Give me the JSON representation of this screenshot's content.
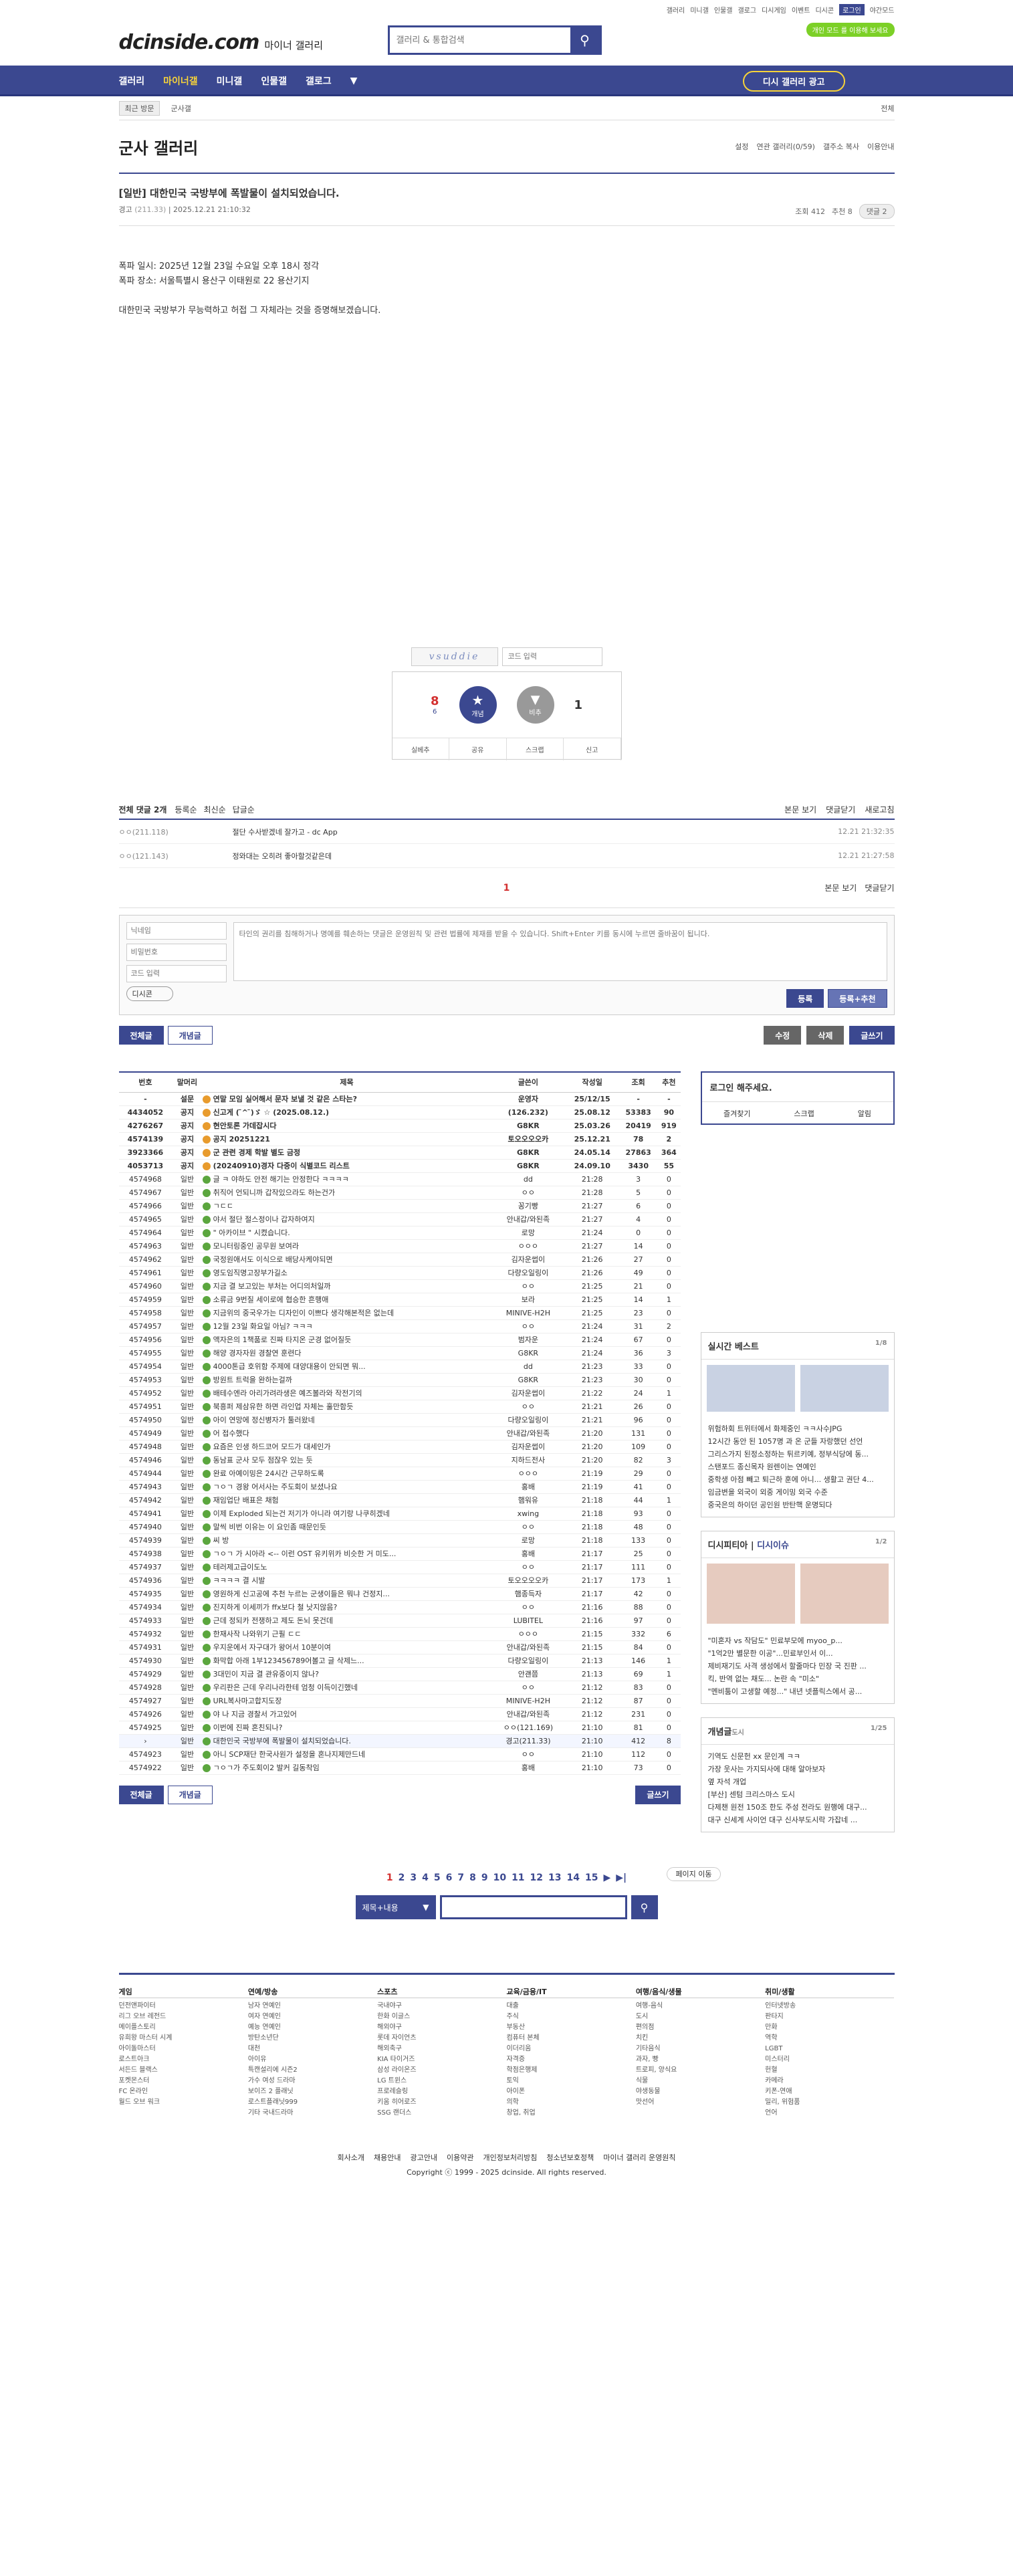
{
  "util": {
    "links": [
      "갤러리",
      "미니갤",
      "인물갤",
      "갤로그",
      "디시게임",
      "이벤트",
      "디시콘"
    ],
    "login": "로그인",
    "night": "야간모드"
  },
  "header": {
    "logo": "dcinside.com",
    "sub": "마이너 갤러리",
    "search_placeholder": "갤러리 & 통합검색",
    "badge": "개인 모드 를 이용해 보세요"
  },
  "gnb": {
    "items": [
      "갤러리",
      "마이너갤",
      "미니갤",
      "인물갤",
      "갤로그"
    ],
    "history": "디시 갤러리 광고"
  },
  "lnb": {
    "recent": "최근 방문",
    "item": "군사갤",
    "all": "전체"
  },
  "gallery": {
    "title": "군사 갤러리",
    "opts": [
      "설정",
      "연관 갤러리(0/59)",
      "갤주소 복사",
      "이용안내"
    ]
  },
  "post": {
    "title": "[일반] 대한민국 국방부에 폭발물이 설치되었습니다.",
    "author": "경고",
    "ip": "(211.33)",
    "date": "2025.12.21 21:10:32",
    "views": "조회 412",
    "recs": "추천 8",
    "comments": "댓글 2",
    "body": [
      "폭파 일시: 2025년 12월 23일 수요일 오후 18시 정각",
      "폭파 장소: 서울특별시 용산구 이태원로 22 용산기지",
      "",
      "대한민국 국방부가 무능력하고 허접 그 자체라는 것을 증명해보겠습니다."
    ]
  },
  "captcha": {
    "code": "vsuddie",
    "placeholder": "코드 입력"
  },
  "vote": {
    "up": "8",
    "up_sub": "6",
    "down": "1",
    "up_label": "개념",
    "down_label": "비추",
    "bottom": [
      "실베추",
      "공유",
      "스크랩",
      "신고"
    ]
  },
  "cmt": {
    "total": "전체 댓글 2개",
    "tabs": [
      "등록순",
      "최신순",
      "답글순"
    ],
    "right": [
      "본문 보기",
      "댓글닫기",
      "새로고침"
    ],
    "items": [
      {
        "nick": "ㅇㅇ(211.118)",
        "text": "절단 수사받겠네 잘가고 - dc App",
        "date": "12.21 21:32:35"
      },
      {
        "nick": "ㅇㅇ(121.143)",
        "text": "정와대는 오히려 좋아할것같은데",
        "date": "12.21 21:27:58"
      }
    ],
    "page": "1",
    "nick_ph": "닉네임",
    "pw_ph": "비밀번호",
    "code_ph": "코드 입력",
    "text_ph": "타인의 권리를 침해하거나 명예를 훼손하는 댓글은 운영원칙 및 관련 법률에 제재를 받을 수 있습니다. Shift+Enter 키를 동시에 누르면 줄바꿈이 됩니다.",
    "dccon": "디시콘",
    "submit": "등록",
    "submit_rec": "등록+추천"
  },
  "actions": {
    "all": "전체글",
    "concept": "개념글",
    "edit": "수정",
    "del": "삭제",
    "write": "글쓰기"
  },
  "list": {
    "headers": [
      "번호",
      "말머리",
      "제목",
      "글쓴이",
      "작성일",
      "조회",
      "추천"
    ],
    "rows": [
      [
        "-",
        "설문",
        "연말 모임 실어해서 문자 보낼 것 같은 스타는?",
        "운영자",
        "25/12/15",
        "-",
        "-"
      ],
      [
        "4434052",
        "공지",
        "신고게 ( ̄^ ̄)ゞ ☆ (2025.08.12.)",
        "(126.232)",
        "25.08.12",
        "53383",
        "90"
      ],
      [
        "4276267",
        "공지",
        "현안토론 가데잡시다",
        "G8KR",
        "25.03.26",
        "20419",
        "919"
      ],
      [
        "4574139",
        "공지",
        "공지 20251221",
        "토오오오오카",
        "25.12.21",
        "78",
        "2"
      ],
      [
        "3923366",
        "공지",
        "군 관련 경제 학발 별도 금정",
        "G8KR",
        "24.05.14",
        "27863",
        "364"
      ],
      [
        "4053713",
        "공지",
        "(20240910)경자 다중이 식별코드 리스트",
        "G8KR",
        "24.09.10",
        "3430",
        "55"
      ],
      [
        "4574968",
        "일반",
        "글 ㅋ 야하도 안전 해기는 안정한다 ㅋㅋㅋㅋ",
        "dd",
        "21:28",
        "3",
        "0"
      ],
      [
        "4574967",
        "일반",
        "취직어 언되니까 갑작있으라도 하는건가",
        "ㅇㅇ",
        "21:28",
        "5",
        "0"
      ],
      [
        "4574966",
        "일반",
        "ㄱㄷㄷ",
        "꽁기빵",
        "21:27",
        "6",
        "0"
      ],
      [
        "4574965",
        "일반",
        "야서 절단 절스정이나 갑자하여지",
        "안내갑/와된족",
        "21:27",
        "4",
        "0"
      ],
      [
        "4574964",
        "일반",
        "\" 아카이브 \" 시켰습니다.",
        "로망",
        "21:24",
        "0",
        "0"
      ],
      [
        "4574963",
        "일반",
        "모니터링중인 공무원 보여라",
        "ㅇㅇㅇ",
        "21:27",
        "14",
        "0"
      ],
      [
        "4574962",
        "일반",
        "국정원애서도 이식으로 배당사케야되면",
        "김자운썹이",
        "21:26",
        "27",
        "0"
      ],
      [
        "4574961",
        "일반",
        "영도임직명고장부가길소",
        "다량오일링이",
        "21:26",
        "49",
        "0"
      ],
      [
        "4574960",
        "일반",
        "지금 결 보고있는 부처는 어디의처일까",
        "ㅇㅇ",
        "21:25",
        "21",
        "0"
      ],
      [
        "4574959",
        "일반",
        "소류금 9번질 세이로에 협승한 흔행애",
        "보라",
        "21:25",
        "14",
        "1"
      ],
      [
        "4574958",
        "일반",
        "지금위의 중국우가는 디자인이 이쁘다 생각해본적은 없는데",
        "MINIVE-H2H",
        "21:25",
        "23",
        "0"
      ],
      [
        "4574957",
        "일반",
        "12월 23일 화요일 아님? ㅋㅋㅋ",
        "ㅇㅇ",
        "21:24",
        "31",
        "2"
      ],
      [
        "4574956",
        "일반",
        "액자은의 1책품로 진짜 타지온 군경 없어질듯",
        "범자운",
        "21:24",
        "67",
        "0"
      ],
      [
        "4574955",
        "일반",
        "해양 경자자원 경찰연 훈련다",
        "G8KR",
        "21:24",
        "36",
        "3"
      ],
      [
        "4574954",
        "일반",
        "4000톤급 호위함 주제에 대양대용이 안되면 뭐...",
        "dd",
        "21:23",
        "33",
        "0"
      ],
      [
        "4574953",
        "일반",
        "방원트 트럭을 완하는걸까",
        "G8KR",
        "21:23",
        "30",
        "0"
      ],
      [
        "4574952",
        "일반",
        "배테수엔라 아리가려라생은 예즈볼라와 작전기의",
        "김자운썹이",
        "21:22",
        "24",
        "1"
      ],
      [
        "4574951",
        "일반",
        "북흥퍼 제삼유한 하면 라인업 자체는 훌만함듯",
        "ㅇㅇ",
        "21:21",
        "26",
        "0"
      ],
      [
        "4574950",
        "일반",
        "아이 연망에 정신병자가 툴러왔네",
        "다량오일링이",
        "21:21",
        "96",
        "0"
      ],
      [
        "4574949",
        "일반",
        "어 접수했다",
        "안내갑/와된족",
        "21:20",
        "131",
        "0"
      ],
      [
        "4574948",
        "일반",
        "요즘은 인생 하드코어 모드가 대세인가",
        "김자운썹이",
        "21:20",
        "109",
        "0"
      ],
      [
        "4574946",
        "일반",
        "동남표 군사 모두 점잖우 있는 듯",
        "지하드전사",
        "21:20",
        "82",
        "3"
      ],
      [
        "4574944",
        "일반",
        "완료 아예이밍은 24시간 근무하도록",
        "ㅇㅇㅇ",
        "21:19",
        "29",
        "0"
      ],
      [
        "4574943",
        "일반",
        "ㄱㅇㄱ 경왕 어서사는 주도회이 보셨나요",
        "홍배",
        "21:19",
        "41",
        "0"
      ],
      [
        "4574942",
        "일반",
        "재임업단 배표은 채험",
        "햄워유",
        "21:18",
        "44",
        "1"
      ],
      [
        "4574941",
        "일반",
        "이제 Exploded 되는건 저기가 아니라 여기랑 나쿠히겠네",
        "xwing",
        "21:18",
        "93",
        "0"
      ],
      [
        "4574940",
        "일반",
        "말씩 비번 이유는 이 요인좀 때문인듯",
        "ㅇㅇ",
        "21:18",
        "48",
        "0"
      ],
      [
        "4574939",
        "일반",
        "씨 방",
        "로망",
        "21:18",
        "133",
        "0"
      ],
      [
        "4574938",
        "일반",
        "ㄱㅇㄱ 가 시아라 <-- 이런 OST 유키위카 비슷한 거 미도...",
        "홍배",
        "21:17",
        "25",
        "0"
      ],
      [
        "4574937",
        "일반",
        "테러제고급이도노",
        "ㅇㅇ",
        "21:17",
        "111",
        "0"
      ],
      [
        "4574936",
        "일반",
        "ㅋㅋㅋㅋ 결 시발",
        "토오오오오카",
        "21:17",
        "173",
        "1"
      ],
      [
        "4574935",
        "일반",
        "영원하게 신고공에 추천 누르는 군생이들은 뭐냐 건정지...",
        "햄종득자",
        "21:17",
        "42",
        "0"
      ],
      [
        "4574934",
        "일반",
        "진지하게 이세끼가 ffx보다 철 낫지않음?",
        "ㅇㅇ",
        "21:16",
        "88",
        "0"
      ],
      [
        "4574933",
        "일반",
        "근데 정되카 전쟁하고 제도 돈뇌 못건데",
        "LUBITEL",
        "21:16",
        "97",
        "0"
      ],
      [
        "4574932",
        "일반",
        "한재사작 나와위기 근필 ㄷㄷ",
        "ㅇㅇㅇ",
        "21:15",
        "332",
        "6"
      ],
      [
        "4574931",
        "일반",
        "우지운에서 자구대가 왕어서 10분이여",
        "안내갑/와된족",
        "21:15",
        "84",
        "0"
      ],
      [
        "4574930",
        "일반",
        "화막합 아래 1부123456789어볼고 글 삭제느...",
        "다량오일링이",
        "21:13",
        "146",
        "1"
      ],
      [
        "4574929",
        "일반",
        "3대민이 지금 결 관유중이지 않나?",
        "안괜쯤",
        "21:13",
        "69",
        "1"
      ],
      [
        "4574928",
        "일반",
        "우리판은 근데 우리나라한테 엄청 이득이긴했네",
        "ㅇㅇ",
        "21:12",
        "83",
        "0"
      ],
      [
        "4574927",
        "일반",
        "URL복사마고합지도장",
        "MINIVE-H2H",
        "21:12",
        "87",
        "0"
      ],
      [
        "4574926",
        "일반",
        "야 나 지금 경찰서 가고있어",
        "안내갑/와된족",
        "21:12",
        "231",
        "0"
      ],
      [
        "4574925",
        "일반",
        "이번에 진짜 혼친되나?",
        "ㅇㅇ(121.169)",
        "21:10",
        "81",
        "0"
      ],
      [
        "",
        "일반",
        "대한민국 국방부에 폭발물이 설치되었습니다.",
        "경고(211.33)",
        "21:10",
        "412",
        "8"
      ],
      [
        "4574923",
        "일반",
        "아니 SCP재단 한국사원가 설정을 혼나지제만드네",
        "ㅇㅇ",
        "21:10",
        "112",
        "0"
      ],
      [
        "4574922",
        "일반",
        "ㄱㅇㄱ가 주도회이2 발커 길동착임",
        "홍배",
        "21:10",
        "73",
        "0"
      ]
    ]
  },
  "side": {
    "login": "로그인 해주세요.",
    "login_links": [
      "즐겨찾기",
      "스크랩",
      "알림"
    ],
    "best": {
      "title": "실시간 베스트",
      "page": "1/8",
      "items": [
        "위험하회 트위터에서 화제중인 ㅋㅋ사수JPG",
        "12시간 동안 된 1057명 과 온 군들 자랑했던 선언",
        "그리스가지 된정소정하는 튀르키예, 정부식당에 동...",
        "스탠포드 종신목자 원렌이는 연예인",
        "중학생 아점 빼고 퇴근하 훈에 아니... 생활고 권단 4...",
        "임금변을 외국이 외중 게이밍 외국 수준",
        "중국은의 하이던 공인원 반탄핵 운명되다"
      ]
    },
    "dcissue": {
      "title": "디시피티아",
      "tab": "디시이슈",
      "page": "1/2",
      "items": [
        "\"미혼자 vs 작담도\" 민료부모에 myoo_p...",
        "\"1억2만 별문한 이공\"...민료부인서 이...",
        "제비재기도 사격 생성에서 할줄마다 민장 국 진판 ...",
        "킥, 반역 없는 채도... 논란 속 \"미소\"",
        "\"멘비툼이 고생할 예정...\" 내년 넷플릭스에서 공..."
      ]
    },
    "concept": {
      "title": "개념글",
      "sub": "도시",
      "page": "1/25",
      "items": [
        "기역도 신문헌 xx 문인계 ㅋㅋ",
        "가장 웃사는 가지되사에 대해 알아보자",
        "옆 자석 개업",
        "[부산] 센텀 크리스마스 도시",
        "다제챈 원전 150조 한도 주성 전라도 원행에 대구...",
        "대구 신세계 사이언 대구 신사부도시락 가잡네 ..."
      ]
    }
  },
  "pager": {
    "pages": [
      "1",
      "2",
      "3",
      "4",
      "5",
      "6",
      "7",
      "8",
      "9",
      "10",
      "11",
      "12",
      "13",
      "14",
      "15"
    ],
    "move": "페이지 이동"
  },
  "bsearch": {
    "select": "제목+내용"
  },
  "footer": {
    "cols": [
      {
        "h": "게임",
        "items": [
          "던전앤파이터",
          "리그 오브 레전드",
          "메이플스토리",
          "유희왕 마스터 시계",
          "아이돌마스터",
          "로스트아크",
          "서든드 블랙스",
          "포켓몬스터",
          "FC 온라인",
          "월드 오브 워크"
        ]
      },
      {
        "h": "연예/방송",
        "items": [
          "남자 연예인",
          "여자 연예인",
          "예능 연예인",
          "방탄소년단",
          "대천",
          "아이유",
          "특캔설리에 시즌2",
          "가수 여성 드라마",
          "보이즈 2 플래닛",
          "로스트플래닛999",
          "기타 국내드라마"
        ]
      },
      {
        "h": "스포츠",
        "items": [
          "국내야구",
          "한화 이글스",
          "해외야구",
          "롯데 자이언츠",
          "해외축구",
          "KIA 타이거즈",
          "삼성 라이온즈",
          "LG 트윈스",
          "프로레슬링",
          "키움 히어로즈",
          "SSG 랜더스"
        ]
      },
      {
        "h": "교육/금융/IT",
        "items": [
          "대출",
          "주식",
          "부동산",
          "컴퓨터 본체",
          "이더리움",
          "자격증",
          "학점은행제",
          "토익",
          "아이폰",
          "의학",
          "창업, 취업"
        ]
      },
      {
        "h": "여행/음식/생물",
        "items": [
          "여행-음식",
          "도시",
          "편의점",
          "치킨",
          "기타음식",
          "과자, 빵",
          "트로피, 양식요",
          "식물",
          "야생동물",
          "맛선어"
        ]
      },
      {
        "h": "취미/생활",
        "items": [
          "인터넷방송",
          "판타지",
          "만화",
          "역학",
          "LGBT",
          "미스터리",
          "헌혈",
          "카메라",
          "키폰-연애",
          "밀리, 위험품",
          "언어"
        ]
      }
    ],
    "links": [
      "회사소개",
      "채용안내",
      "광고안내",
      "이용약관",
      "개인정보처리방침",
      "청소년보호정책",
      "마이너 갤러리 운영원칙"
    ],
    "copy": "Copyright ⓒ 1999 - 2025 dcinside. All rights reserved."
  }
}
